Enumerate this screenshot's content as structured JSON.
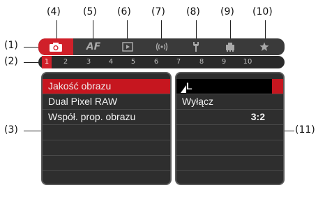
{
  "callouts": {
    "c1": "(1)",
    "c2": "(2)",
    "c3": "(3)",
    "c4": "(4)",
    "c5": "(5)",
    "c6": "(6)",
    "c7": "(7)",
    "c8": "(8)",
    "c9": "(9)",
    "c10": "(10)",
    "c11": "(11)"
  },
  "tabs": [
    {
      "icon": "camera-icon"
    },
    {
      "label": "AF",
      "icon": "af-text-icon"
    },
    {
      "icon": "playback-icon"
    },
    {
      "icon": "wireless-icon"
    },
    {
      "icon": "wrench-icon"
    },
    {
      "icon": "custom-functions-icon"
    },
    {
      "icon": "star-icon"
    }
  ],
  "pages": [
    "1",
    "2",
    "3",
    "4",
    "5",
    "6",
    "7",
    "8",
    "9",
    "10"
  ],
  "active_page": "1",
  "menu_items": [
    "Jakość obrazu",
    "Dual Pixel RAW",
    "Współ. prop. obrazu"
  ],
  "settings": {
    "image_quality": "L",
    "dual_pixel_raw": "Wyłącz",
    "aspect_ratio": "3:2"
  },
  "colors": {
    "accent": "#d0202a",
    "panel": "#2e2e2e",
    "tabbar": "#3a3a3a"
  }
}
